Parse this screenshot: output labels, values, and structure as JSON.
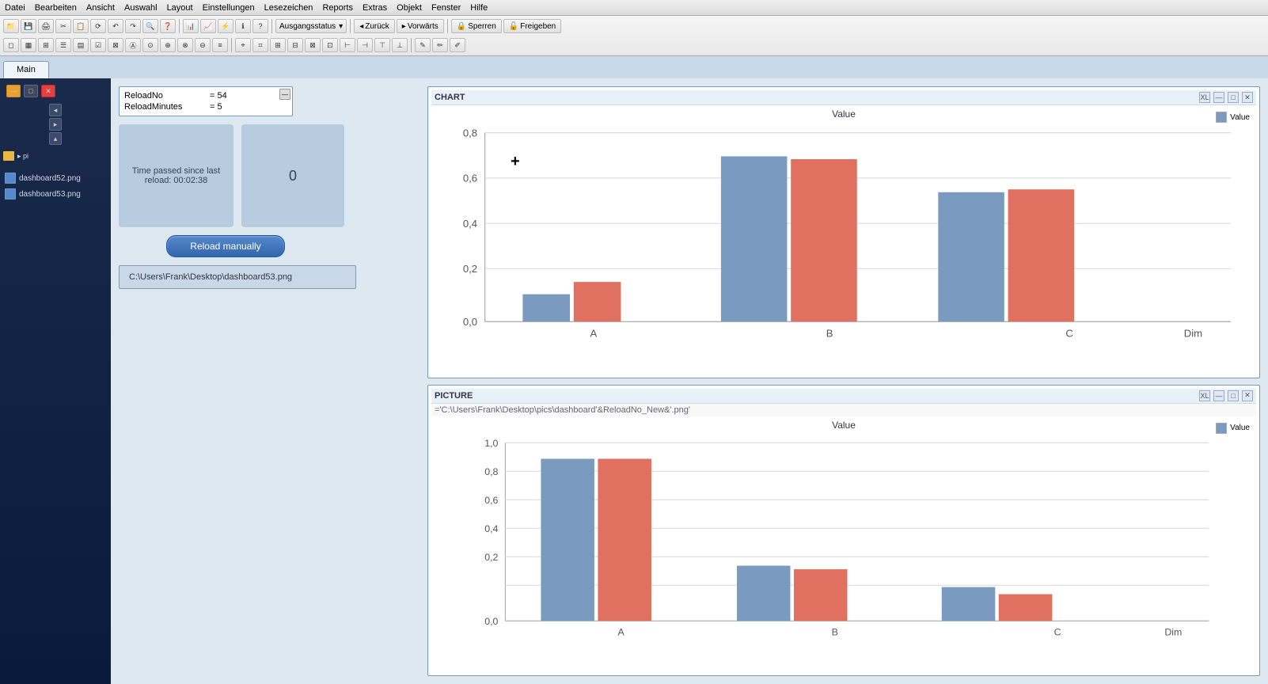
{
  "menubar": {
    "items": [
      "Datei",
      "Bearbeiten",
      "Ansicht",
      "Auswahl",
      "Layout",
      "Einstellungen",
      "Lesezeichen",
      "Reports",
      "Extras",
      "Objekt",
      "Fenster",
      "Hilfe"
    ]
  },
  "toolbar": {
    "ausgangsstatus": "Ausgangsstatus",
    "zuruck": "Zurück",
    "vorwarts": "Vorwärts",
    "sperren": "Sperren",
    "freigeben": "Freigeben"
  },
  "tab": {
    "label": "Main"
  },
  "sidebar": {
    "files": [
      {
        "name": "dashboard52.png"
      },
      {
        "name": "dashboard53.png"
      }
    ]
  },
  "data_box": {
    "fields": [
      {
        "label": "ReloadNo",
        "value": "= 54"
      },
      {
        "label": "ReloadMinutes",
        "value": "= 5"
      }
    ]
  },
  "info_box_left": {
    "text": "Time passed since last reload: 00:02:38"
  },
  "info_box_right": {
    "text": "0"
  },
  "reload_button": {
    "label": "Reload manually"
  },
  "filepath": {
    "value": "C:\\Users\\Frank\\Desktop\\dashboard53.png"
  },
  "chart_top": {
    "title": "CHART",
    "subtitle": "",
    "value_label": "Value",
    "legend": "Value",
    "y_labels": [
      "0,8",
      "0,6",
      "0,4",
      "0,2",
      "0,0"
    ],
    "x_labels": [
      "A",
      "B",
      "C",
      "Dim"
    ],
    "bars": {
      "A": {
        "blue": 0.12,
        "red": 0.18
      },
      "B": {
        "blue": 0.7,
        "red": 0.68
      },
      "C": {
        "blue": 0.55,
        "red": 0.56
      },
      "Dim": {
        "blue": 0.0,
        "red": 0.0
      }
    }
  },
  "chart_bottom": {
    "title": "PICTURE",
    "formula": "='C:\\Users\\Frank\\Desktop\\pics\\dashboard'&ReloadNo_New&'.png'",
    "value_label": "Value",
    "legend": "Value",
    "y_labels": [
      "1,0",
      "0,8",
      "0,6",
      "0,4",
      "0,2",
      "0,0"
    ],
    "x_labels": [
      "A",
      "B",
      "C",
      "Dim"
    ],
    "bars": {
      "A": {
        "blue": 0.86,
        "red": 0.86
      },
      "B": {
        "blue": 0.3,
        "red": 0.28
      },
      "C": {
        "blue": 0.18,
        "red": 0.14
      },
      "Dim": {
        "blue": 0.0,
        "red": 0.0
      }
    }
  },
  "colors": {
    "bar_blue": "#7a9bbf",
    "bar_red": "#e07060",
    "chart_bg": "#ffffff",
    "grid_line": "#dddddd"
  }
}
